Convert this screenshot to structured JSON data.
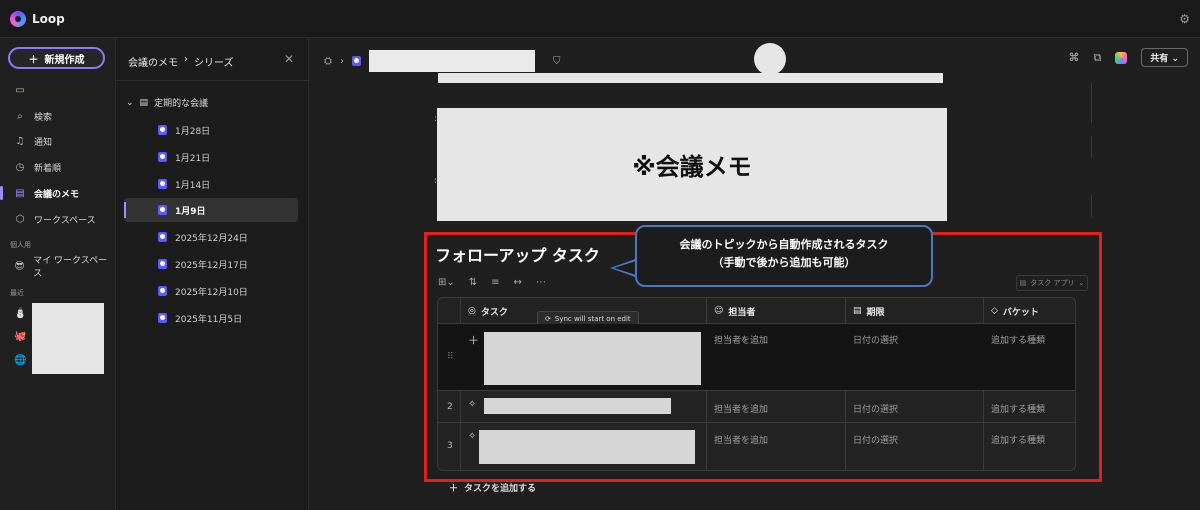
{
  "app": {
    "name": "Loop"
  },
  "sidebar": {
    "new_button": "新規作成",
    "items": [
      {
        "label": "",
        "icon": "rectangle-icon"
      },
      {
        "label": "検索",
        "icon": "search-icon"
      },
      {
        "label": "通知",
        "icon": "bell-icon"
      },
      {
        "label": "新着順",
        "icon": "clock-icon"
      },
      {
        "label": "会議のメモ",
        "icon": "notes-icon"
      },
      {
        "label": "ワークスペース",
        "icon": "workspace-icon"
      }
    ],
    "personal_label": "個人用",
    "my_workspace": "マイ ワークスペース",
    "recent_label": "最近"
  },
  "series": {
    "breadcrumb_parent": "会議のメモ",
    "breadcrumb_sep": "›",
    "breadcrumb_current": "シリーズ",
    "parent": "定期的な会議",
    "items": [
      "1月28日",
      "1月21日",
      "1月14日",
      "1月9日",
      "2025年12月24日",
      "2025年12月17日",
      "2025年12月10日",
      "2025年11月5日"
    ]
  },
  "header": {
    "share": "共有"
  },
  "doc": {
    "memo_title": "※会議メモ",
    "task_title": "フォローアップ タスク",
    "callout_line1": "会議のトピックから自動作成されるタスク",
    "callout_line2": "（手動で後から追加も可能）",
    "task_app": "タスク アプリ",
    "sync_tip": "Sync will start on edit",
    "add_task": "タスクを追加する"
  },
  "table": {
    "headers": {
      "task": "タスク",
      "assignee": "担当者",
      "due": "期限",
      "bucket": "バケット"
    },
    "rows": [
      {
        "num": "",
        "assignee": "担当者を追加",
        "due": "日付の選択",
        "bucket": "追加する種類"
      },
      {
        "num": "2",
        "assignee": "担当者を追加",
        "due": "日付の選択",
        "bucket": "追加する種類"
      },
      {
        "num": "3",
        "assignee": "担当者を追加",
        "due": "日付の選択",
        "bucket": "追加する種類"
      }
    ]
  },
  "colors": {
    "accent": "#8d79ff",
    "highlight": "#e0201b",
    "callout_border": "#4a78c8"
  }
}
